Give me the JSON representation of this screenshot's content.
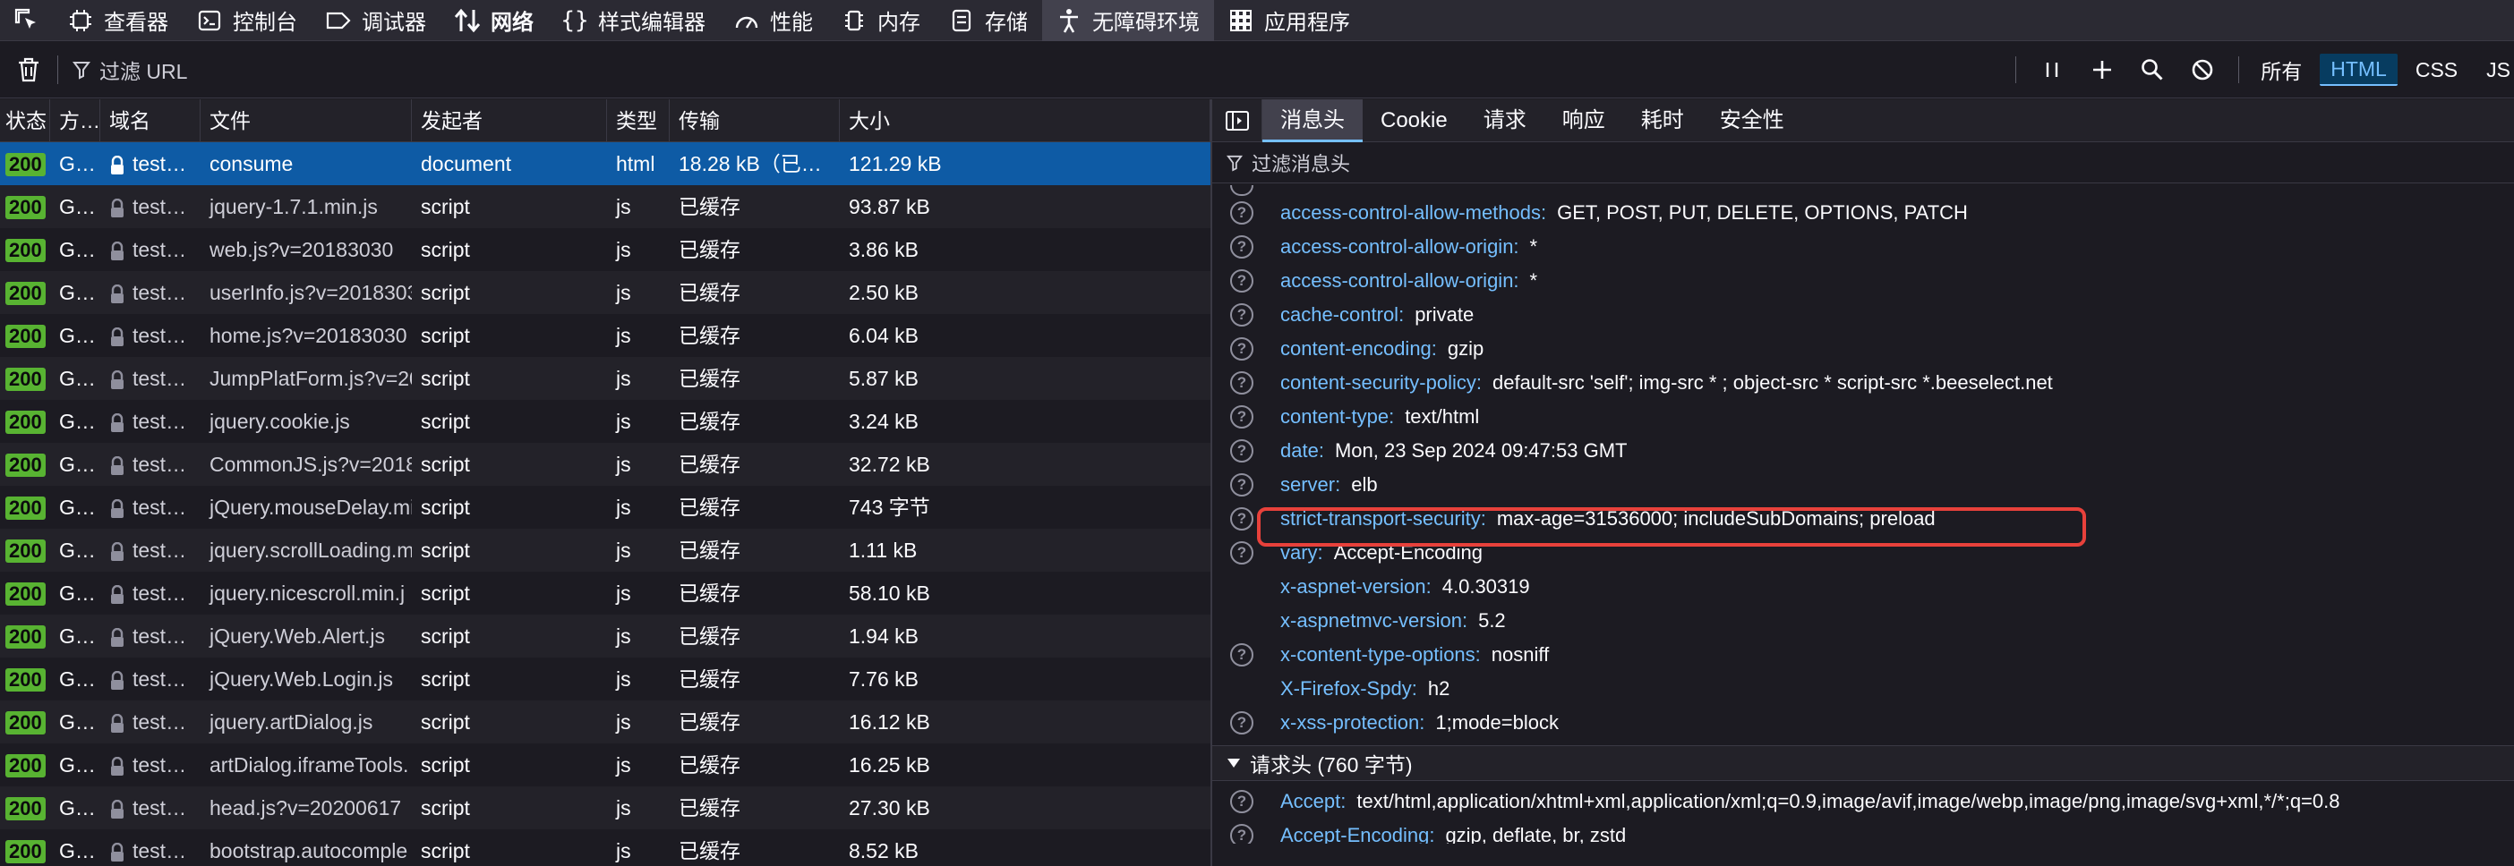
{
  "toolbar": {
    "tools": [
      {
        "label": "查看器",
        "icon": "inspector-icon"
      },
      {
        "label": "控制台",
        "icon": "console-icon"
      },
      {
        "label": "调试器",
        "icon": "debugger-icon"
      },
      {
        "label": "网络",
        "icon": "network-arrows-icon"
      },
      {
        "label": "样式编辑器",
        "icon": "braces-icon"
      },
      {
        "label": "性能",
        "icon": "gauge-icon"
      },
      {
        "label": "内存",
        "icon": "memory-chip-icon"
      },
      {
        "label": "存储",
        "icon": "storage-icon"
      },
      {
        "label": "无障碍环境",
        "icon": "accessibility-icon"
      },
      {
        "label": "应用程序",
        "icon": "grid-icon"
      }
    ],
    "active_tool": "网络"
  },
  "filterbar": {
    "placeholder": "过滤 URL",
    "type_filters": [
      "所有",
      "HTML",
      "CSS",
      "JS"
    ],
    "active_type": "HTML"
  },
  "table": {
    "headers": [
      "状态",
      "方…",
      "域名",
      "文件",
      "发起者",
      "类型",
      "传输",
      "大小"
    ],
    "rows": [
      {
        "status": "200",
        "method": "G…",
        "domain": "test…",
        "file": "consume",
        "initiator": "document",
        "type": "html",
        "transfer": "18.28 kB（已…",
        "size": "121.29 kB"
      },
      {
        "status": "200",
        "method": "G…",
        "domain": "test…",
        "file": "jquery-1.7.1.min.js",
        "initiator": "script",
        "type": "js",
        "transfer": "已缓存",
        "size": "93.87 kB"
      },
      {
        "status": "200",
        "method": "G…",
        "domain": "test…",
        "file": "web.js?v=20183030",
        "initiator": "script",
        "type": "js",
        "transfer": "已缓存",
        "size": "3.86 kB"
      },
      {
        "status": "200",
        "method": "G…",
        "domain": "test…",
        "file": "userInfo.js?v=2018303",
        "initiator": "script",
        "type": "js",
        "transfer": "已缓存",
        "size": "2.50 kB"
      },
      {
        "status": "200",
        "method": "G…",
        "domain": "test…",
        "file": "home.js?v=20183030",
        "initiator": "script",
        "type": "js",
        "transfer": "已缓存",
        "size": "6.04 kB"
      },
      {
        "status": "200",
        "method": "G…",
        "domain": "test…",
        "file": "JumpPlatForm.js?v=20",
        "initiator": "script",
        "type": "js",
        "transfer": "已缓存",
        "size": "5.87 kB"
      },
      {
        "status": "200",
        "method": "G…",
        "domain": "test…",
        "file": "jquery.cookie.js",
        "initiator": "script",
        "type": "js",
        "transfer": "已缓存",
        "size": "3.24 kB"
      },
      {
        "status": "200",
        "method": "G…",
        "domain": "test…",
        "file": "CommonJS.js?v=2018",
        "initiator": "script",
        "type": "js",
        "transfer": "已缓存",
        "size": "32.72 kB"
      },
      {
        "status": "200",
        "method": "G…",
        "domain": "test…",
        "file": "jQuery.mouseDelay.mi",
        "initiator": "script",
        "type": "js",
        "transfer": "已缓存",
        "size": "743 字节"
      },
      {
        "status": "200",
        "method": "G…",
        "domain": "test…",
        "file": "jquery.scrollLoading.m",
        "initiator": "script",
        "type": "js",
        "transfer": "已缓存",
        "size": "1.11 kB"
      },
      {
        "status": "200",
        "method": "G…",
        "domain": "test…",
        "file": "jquery.nicescroll.min.j",
        "initiator": "script",
        "type": "js",
        "transfer": "已缓存",
        "size": "58.10 kB"
      },
      {
        "status": "200",
        "method": "G…",
        "domain": "test…",
        "file": "jQuery.Web.Alert.js",
        "initiator": "script",
        "type": "js",
        "transfer": "已缓存",
        "size": "1.94 kB"
      },
      {
        "status": "200",
        "method": "G…",
        "domain": "test…",
        "file": "jQuery.Web.Login.js",
        "initiator": "script",
        "type": "js",
        "transfer": "已缓存",
        "size": "7.76 kB"
      },
      {
        "status": "200",
        "method": "G…",
        "domain": "test…",
        "file": "jquery.artDialog.js",
        "initiator": "script",
        "type": "js",
        "transfer": "已缓存",
        "size": "16.12 kB"
      },
      {
        "status": "200",
        "method": "G…",
        "domain": "test…",
        "file": "artDialog.iframeTools.",
        "initiator": "script",
        "type": "js",
        "transfer": "已缓存",
        "size": "16.25 kB"
      },
      {
        "status": "200",
        "method": "G…",
        "domain": "test…",
        "file": "head.js?v=20200617",
        "initiator": "script",
        "type": "js",
        "transfer": "已缓存",
        "size": "27.30 kB"
      },
      {
        "status": "200",
        "method": "G…",
        "domain": "test…",
        "file": "bootstrap.autocomple",
        "initiator": "script",
        "type": "js",
        "transfer": "已缓存",
        "size": "8.52 kB"
      }
    ]
  },
  "panel": {
    "tabs": [
      "消息头",
      "Cookie",
      "请求",
      "响应",
      "耗时",
      "安全性"
    ],
    "active_tab": "消息头",
    "filter_placeholder": "过滤消息头",
    "response_headers": [
      {
        "name": "access-control-allow-methods:",
        "value": "GET, POST, PUT, DELETE, OPTIONS, PATCH",
        "help": true
      },
      {
        "name": "access-control-allow-origin:",
        "value": "*",
        "help": true
      },
      {
        "name": "access-control-allow-origin:",
        "value": "*",
        "help": true
      },
      {
        "name": "cache-control:",
        "value": "private",
        "help": true
      },
      {
        "name": "content-encoding:",
        "value": "gzip",
        "help": true
      },
      {
        "name": "content-security-policy:",
        "value": "default-src 'self'; img-src * ; object-src * script-src *.beeselect.net",
        "help": true
      },
      {
        "name": "content-type:",
        "value": "text/html",
        "help": true
      },
      {
        "name": "date:",
        "value": "Mon, 23 Sep 2024 09:47:53 GMT",
        "help": true
      },
      {
        "name": "server:",
        "value": "elb",
        "help": true
      },
      {
        "name": "strict-transport-security:",
        "value": "max-age=31536000; includeSubDomains; preload",
        "help": true
      },
      {
        "name": "vary:",
        "value": "Accept-Encoding",
        "help": true
      },
      {
        "name": "x-aspnet-version:",
        "value": "4.0.30319",
        "help": false
      },
      {
        "name": "x-aspnetmvc-version:",
        "value": "5.2",
        "help": false
      },
      {
        "name": "x-content-type-options:",
        "value": "nosniff",
        "help": true
      },
      {
        "name": "X-Firefox-Spdy:",
        "value": "h2",
        "help": false
      },
      {
        "name": "x-xss-protection:",
        "value": "1;mode=block",
        "help": true
      }
    ],
    "request_section_title": "请求头 (760 字节)",
    "request_headers": [
      {
        "name": "Accept:",
        "value": "text/html,application/xhtml+xml,application/xml;q=0.9,image/avif,image/webp,image/png,image/svg+xml,*/*;q=0.8",
        "help": true
      },
      {
        "name": "Accept-Encoding:",
        "value": "gzip, deflate, br, zstd",
        "help": true
      }
    ],
    "highlighted_header": "strict-transport-security:"
  }
}
